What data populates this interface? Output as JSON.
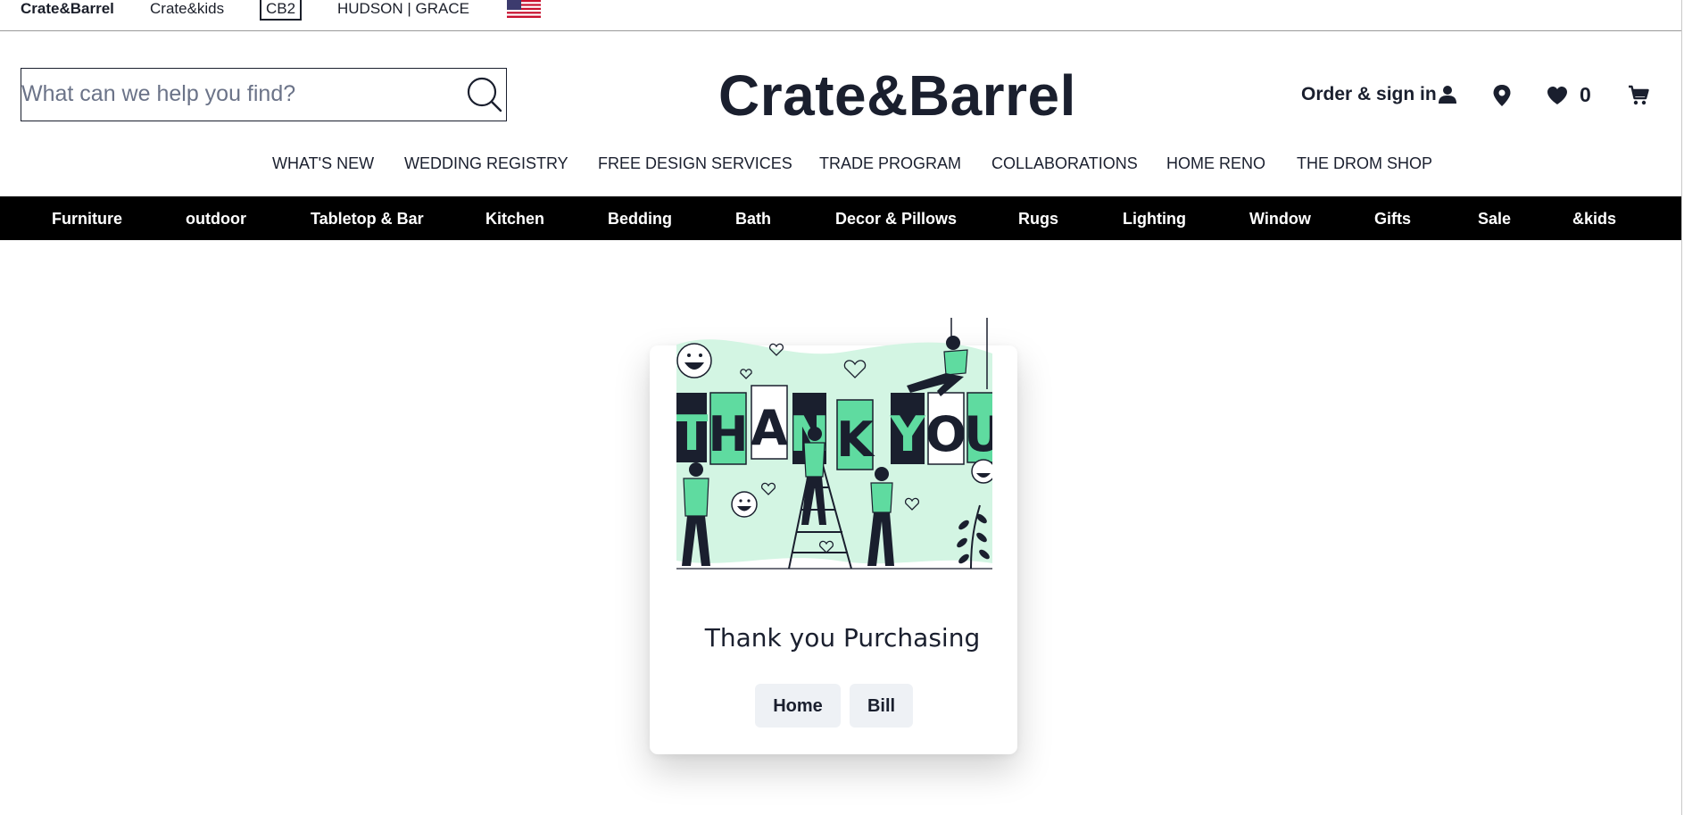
{
  "brand_bar": {
    "items": [
      {
        "label": "Crate&Barrel"
      },
      {
        "label": "Crate&kids"
      },
      {
        "label": "CB2"
      },
      {
        "label": "HUDSON | GRACE"
      }
    ],
    "flag_icon": "us-flag-icon"
  },
  "header": {
    "search": {
      "placeholder": "What can we help you find?",
      "value": ""
    },
    "logo": "Crate&Barrel",
    "account_label": "Order & sign in",
    "wishlist_count": "0",
    "icons": [
      "search-icon",
      "user-icon",
      "location-pin-icon",
      "heart-icon",
      "cart-icon"
    ]
  },
  "utility_nav": [
    {
      "label": "WHAT'S NEW"
    },
    {
      "label": "WEDDING REGISTRY"
    },
    {
      "label": "FREE DESIGN SERVICES"
    },
    {
      "label": "TRADE PROGRAM"
    },
    {
      "label": "COLLABORATIONS"
    },
    {
      "label": "HOME RENO"
    },
    {
      "label": "THE DROM SHOP"
    }
  ],
  "category_nav": [
    {
      "label": "Furniture"
    },
    {
      "label": "outdoor"
    },
    {
      "label": "Tabletop & Bar"
    },
    {
      "label": "Kitchen"
    },
    {
      "label": "Bedding"
    },
    {
      "label": "Bath"
    },
    {
      "label": "Decor & Pillows"
    },
    {
      "label": "Rugs"
    },
    {
      "label": "Lighting"
    },
    {
      "label": "Window"
    },
    {
      "label": "Gifts"
    },
    {
      "label": "Sale"
    },
    {
      "label": "&kids"
    }
  ],
  "confirmation": {
    "illustration_text": "THANK YOU",
    "title": "Thank you Purchasing",
    "buttons": [
      {
        "label": "Home"
      },
      {
        "label": "Bill"
      }
    ]
  },
  "colors": {
    "accent_green": "#5fdba0",
    "pale_green": "#d3f5e3",
    "dark_ink": "#1a1f2e",
    "category_bar": "#000000",
    "button_bg": "#eef1f5"
  }
}
